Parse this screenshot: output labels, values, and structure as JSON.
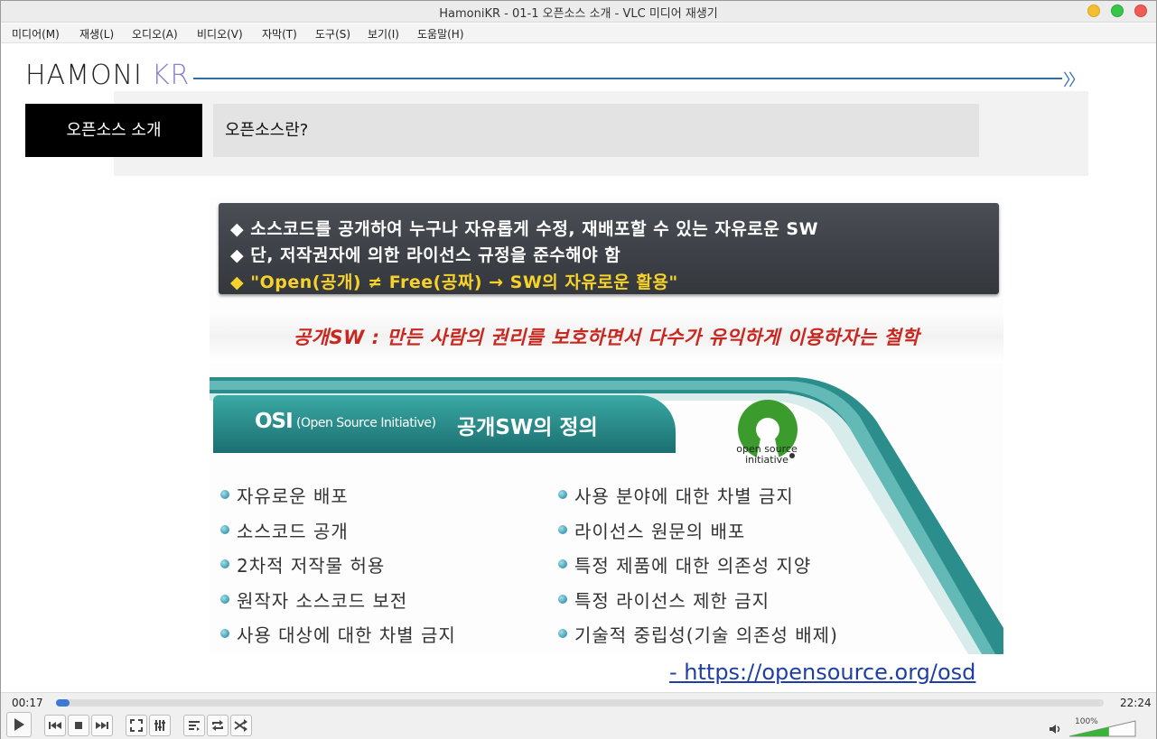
{
  "window": {
    "title": "HamoniKR - 01-1  오픈소스 소개 - VLC 미디어 재생기"
  },
  "menu": [
    {
      "label": "미디어(M)"
    },
    {
      "label": "재생(L)"
    },
    {
      "label": "오디오(A)"
    },
    {
      "label": "비디오(V)"
    },
    {
      "label": "자막(T)"
    },
    {
      "label": "도구(S)"
    },
    {
      "label": "보기(I)"
    },
    {
      "label": "도움말(H)"
    }
  ],
  "slide": {
    "logo_left": "HAMONI",
    "logo_right": "KR",
    "header_arrows": "〉〉",
    "section": "오픈소스 소개",
    "question": "오픈소스란?",
    "bullets": [
      "◆ 소스코드를 공개하여 누구나 자유롭게 수정, 재배포할 수 있는 자유로운  SW",
      "◆ 단, 저작권자에 의한 라이선스 규정을 준수해야 함"
    ],
    "bullet_open": "◆ \"Open(공개) ≠ Free(공짜) → SW의 자유로운 활용\"",
    "philosophy": "공개SW : 만든 사람의 권리를 보호하면서 다수가 유익하게 이용하자는 철학",
    "osi_big": "OSI",
    "osi_small": "(Open Source Initiative)",
    "osi_kr": "공개SW의 정의",
    "osi_logo_text": "open source initiative",
    "left_items": [
      "자유로운 배포",
      "소스코드 공개",
      "2차적 저작물 허용",
      "원작자 소스코드 보전",
      "사용 대상에 대한 차별 금지"
    ],
    "right_items": [
      "사용 분야에 대한 차별 금지",
      "라이선스 원문의 배포",
      "특정 제품에 대한 의존성 지양",
      "특정 라이선스 제한 금지",
      "기술적 중립성(기술 의존성 배제)"
    ],
    "link": "- https://opensource.org/osd"
  },
  "player": {
    "elapsed": "00:17",
    "total": "22:24",
    "progress_fraction": 0.013,
    "volume_label": "100%",
    "volume_fraction": 0.6
  },
  "colors": {
    "accent": "#3a7ad4",
    "osi_teal": "#1b6f70",
    "red_text": "#c8281f",
    "yellow_text": "#f6d22b",
    "logo_purple": "#8a7fc9"
  }
}
